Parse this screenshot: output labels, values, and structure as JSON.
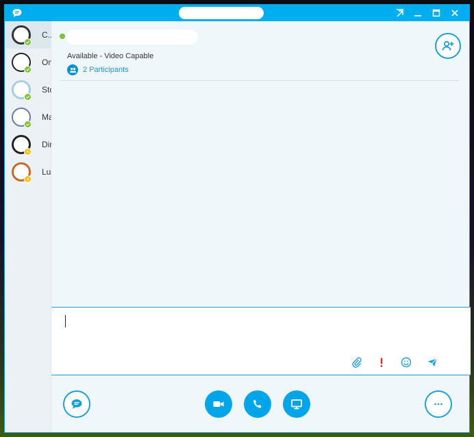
{
  "colors": {
    "accent": "#00adef",
    "available": "#7cc13a",
    "away": "#f7c21b",
    "link": "#1a95d4"
  },
  "titlebar": {
    "icon": "skype-chat-icon",
    "buttons": [
      "pin-to-top-icon",
      "minimize-icon",
      "maximize-icon",
      "close-icon"
    ]
  },
  "contacts": [
    {
      "label": "C...",
      "status": "available",
      "selected": true
    },
    {
      "label": "On",
      "status": "available",
      "selected": false
    },
    {
      "label": "Sto",
      "status": "available",
      "selected": false
    },
    {
      "label": "Ma",
      "status": "available",
      "selected": false
    },
    {
      "label": "Dir",
      "status": "away",
      "selected": false
    },
    {
      "label": "Luc",
      "status": "away",
      "selected": false
    }
  ],
  "conversation": {
    "status_text": "Available - Video Capable",
    "participants_label": "2 Participants"
  },
  "compose": {
    "value": "",
    "tools": [
      "attach-icon",
      "high-importance-icon",
      "emoticon-icon",
      "send-icon"
    ]
  },
  "bottom": {
    "buttons": [
      "im-icon",
      "video-icon",
      "phone-icon",
      "share-screen-icon",
      "more-options-icon"
    ]
  }
}
